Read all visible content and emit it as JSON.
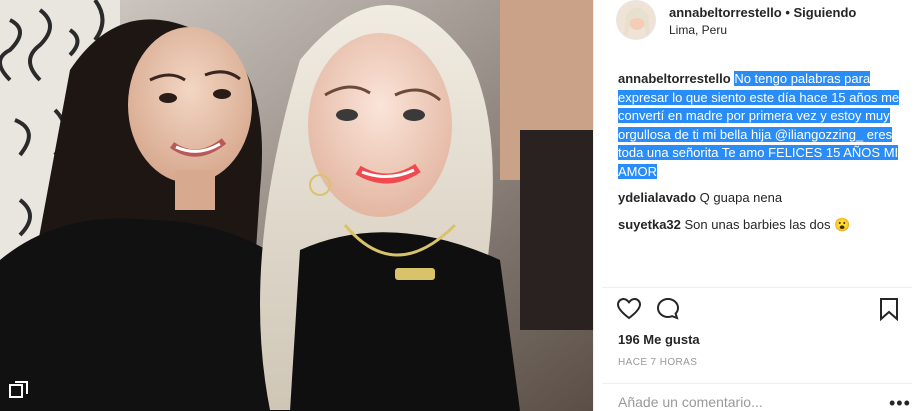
{
  "post": {
    "author": "annabeltorrestello",
    "separator": "•",
    "follow_status": "Siguiendo",
    "location": "Lima, Peru"
  },
  "caption": {
    "user": "annabeltorrestello",
    "text": "No tengo palabras para expresar lo que siento este día hace 15 años me convertí en madre por primera vez y estoy muy orgullosa de ti mi bella hija @iliangozzing_ eres toda una señorita Te amo FELICES 15 AÑOS MI AMOR"
  },
  "comments": [
    {
      "user": "ydelialavado",
      "text": "Q guapa nena"
    },
    {
      "user": "suyetka32",
      "text": "Son unas barbies las dos 😮"
    }
  ],
  "likes": "196 Me gusta",
  "timestamp": "HACE 7 HORAS",
  "add_comment": {
    "placeholder": "Añade un comentario..."
  },
  "icons": {
    "like": "heart-outline-icon",
    "comment": "speech-bubble-icon",
    "save": "bookmark-icon",
    "more": "ellipsis-icon",
    "multi": "multi-photo-icon"
  },
  "colors": {
    "selection": "#2a8df7",
    "text": "#262626",
    "muted": "#999999"
  }
}
